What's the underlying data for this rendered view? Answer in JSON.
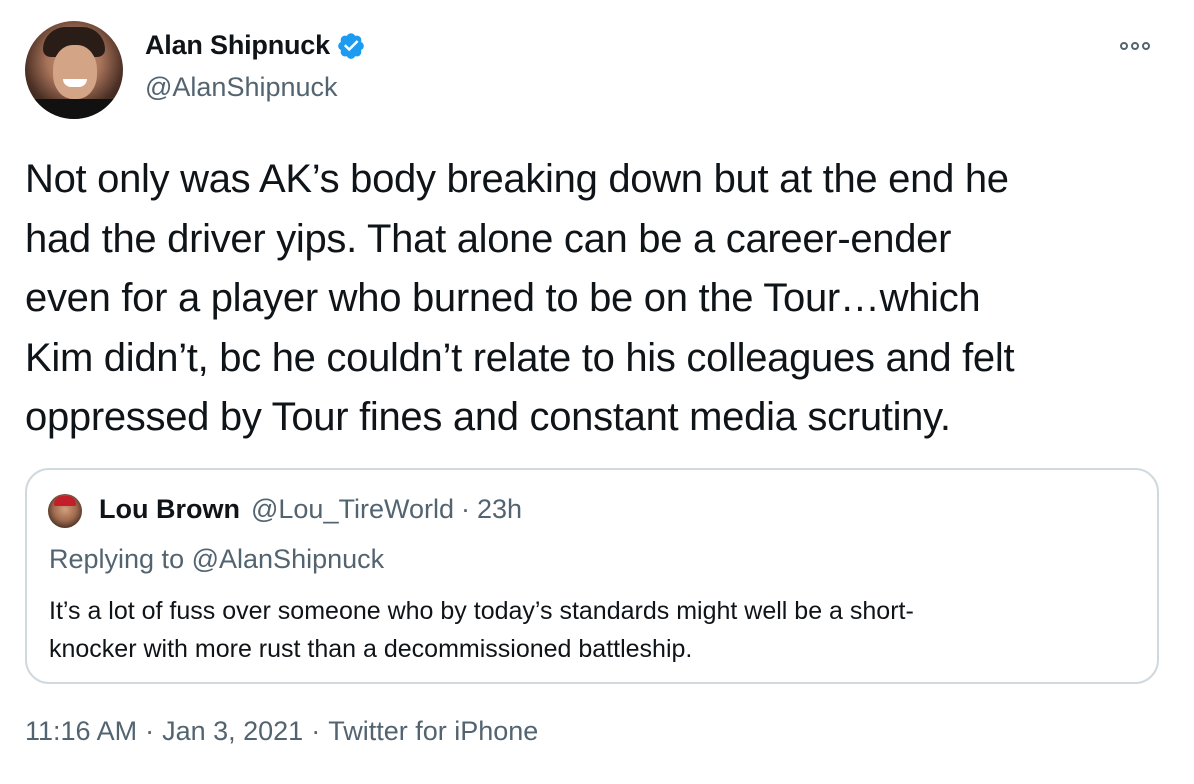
{
  "author": {
    "display_name": "Alan Shipnuck",
    "handle": "@AlanShipnuck",
    "verified": true
  },
  "tweet": {
    "lines": [
      "Not only was AK’s body breaking down but at the end he",
      "had the driver yips. That alone can be a career-ender",
      "even for a player who burned to be on the Tour…which",
      "Kim didn’t, bc he couldn’t relate to his colleagues and felt",
      "oppressed by Tour fines and constant media scrutiny."
    ]
  },
  "quoted_tweet": {
    "display_name": "Lou Brown",
    "handle": "@Lou_TireWorld",
    "separator": "·",
    "time": "23h",
    "replying_prefix": "Replying to",
    "replying_handle": "@AlanShipnuck",
    "lines": [
      "It’s a lot of fuss over someone who by today’s standards might well be a short-",
      "knocker with more rust than a decommissioned battleship."
    ]
  },
  "footer": {
    "time": "11:16 AM",
    "separator": "·",
    "date": "Jan 3, 2021",
    "source": "Twitter for iPhone"
  },
  "colors": {
    "verified": "#1d9bf0",
    "secondary_text": "#536471",
    "border": "#cfd9de"
  }
}
